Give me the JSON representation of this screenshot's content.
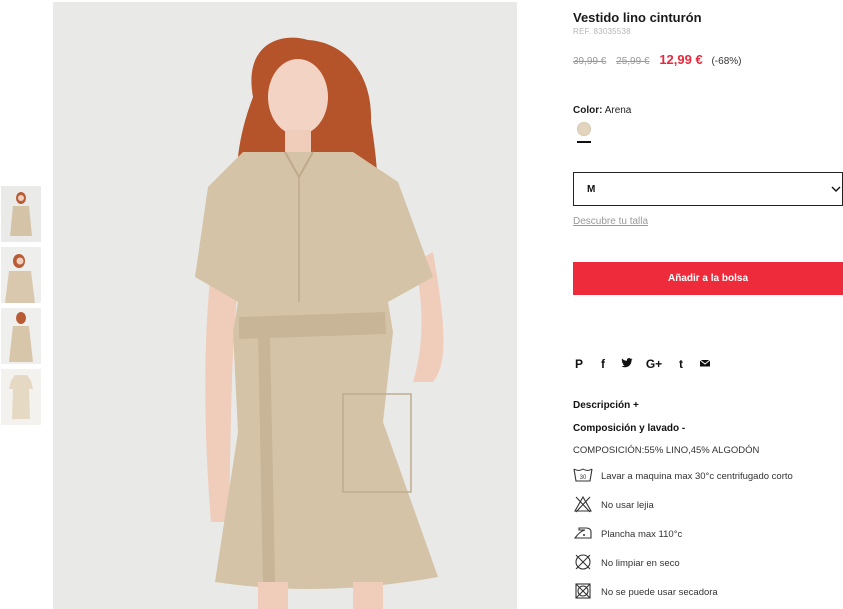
{
  "product": {
    "title": "Vestido lino cinturón",
    "ref": "REF. 83035538",
    "price_original": "39,99 €",
    "price_previous": "25,99 €",
    "price_current": "12,99 €",
    "discount": "(-68%)",
    "color_label": "Color:",
    "color_value": "Arena",
    "color_swatch": "#e2d4bd",
    "size_selected": "M",
    "size_guide_link": "Descubre tu talla",
    "add_to_bag": "Añadir a la bolsa"
  },
  "share": {
    "icons": [
      "pinterest-icon",
      "facebook-icon",
      "twitter-icon",
      "google-plus-icon",
      "tumblr-icon",
      "email-icon"
    ],
    "pinterest": "P",
    "facebook": "f",
    "google_plus": "G+",
    "tumblr": "t"
  },
  "details": {
    "description_label": "Descripción +",
    "composition_label": "Composición y lavado -",
    "composition_text": "COMPOSICIÓN:55% LINO,45% ALGODÓN",
    "care": [
      {
        "icon": "wash-30-icon",
        "badge": "30",
        "text": "Lavar a maquina max 30°c centrifugado corto"
      },
      {
        "icon": "no-bleach-icon",
        "text": "No usar lejia"
      },
      {
        "icon": "iron-low-icon",
        "text": "Plancha max 110°c"
      },
      {
        "icon": "no-dry-clean-icon",
        "text": "No limpiar en seco"
      },
      {
        "icon": "no-tumble-dry-icon",
        "text": "No se puede usar secadora"
      }
    ]
  },
  "colors": {
    "accent": "#ee2b3b",
    "price_red": "#e8283d",
    "dress": "#d5c3a8"
  }
}
